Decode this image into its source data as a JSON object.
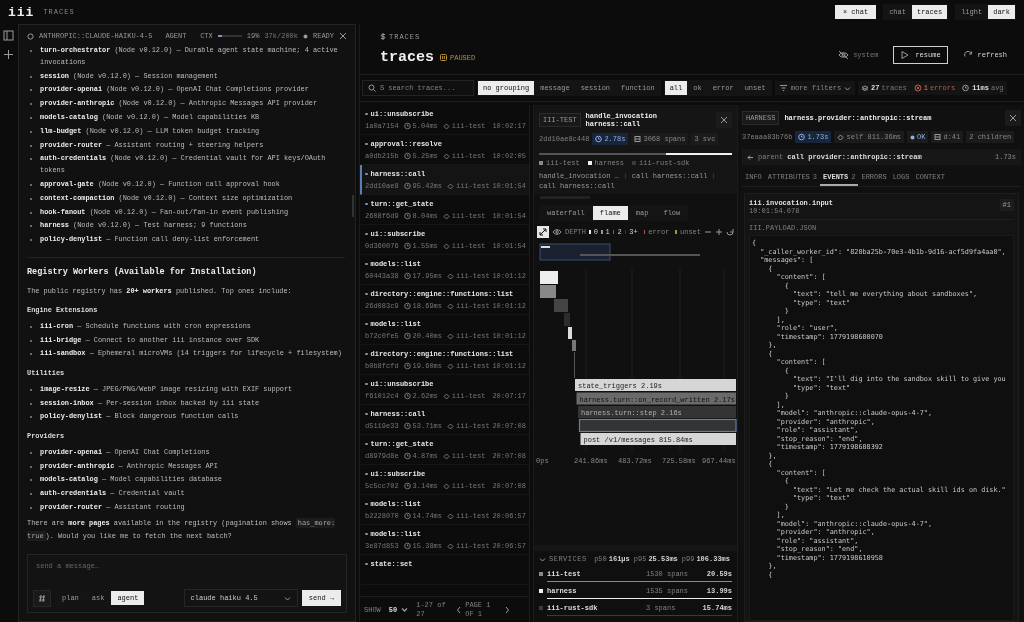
{
  "app": {
    "logo": "iii",
    "section": "TRACES"
  },
  "top_bar": {
    "close_chat": "× chat",
    "view_toggle": [
      {
        "label": "chat",
        "selected": false
      },
      {
        "label": "traces",
        "selected": true
      }
    ],
    "theme_toggle": [
      {
        "label": "light",
        "selected": false
      },
      {
        "label": "dark",
        "selected": true
      }
    ]
  },
  "chat": {
    "model": "ANTHROPIC::CLAUDE-HAIKU-4-5",
    "mode": "AGENT",
    "ctx_label": "CTX",
    "ctx": {
      "level": 0.19
    },
    "ctx_percent": "19%",
    "ctx_tokens": "37k/200k",
    "status": "READY",
    "blocks": [
      {
        "kind": "item",
        "text": "**turn-orchestrator** (Node v0.12.0) — Durable agent state machine; 4 active invocations"
      },
      {
        "kind": "item",
        "text": "**session** (Node v0.12.0) — Session management"
      },
      {
        "kind": "item",
        "text": "**provider-openai** (Node v0.12.0) — OpenAI Chat Completions provider"
      },
      {
        "kind": "item",
        "text": "**provider-anthropic** (Node v0.12.0) — Anthropic Messages API provider"
      },
      {
        "kind": "item",
        "text": "**models-catalog** (Node v0.12.0) — Model capabilities KB"
      },
      {
        "kind": "item",
        "text": "**llm-budget** (Node v0.12.0) — LLM token budget tracking"
      },
      {
        "kind": "item",
        "text": "**provider-router** — Assistant routing + steering helpers"
      },
      {
        "kind": "item",
        "text": "**auth-credentials** (Node v0.12.0) — Credential vault for API keys/OAuth tokens"
      },
      {
        "kind": "item",
        "text": "**approval-gate** (Node v0.12.0) — Function call approval hook"
      },
      {
        "kind": "item",
        "text": "**context-compaction** (Node v0.12.0) — Context size optimization"
      },
      {
        "kind": "item",
        "text": "**hook-fanout** (Node v0.12.0) — Fan-out/fan-in event publishing"
      },
      {
        "kind": "item",
        "text": "**harness** (Node v0.12.0) — Test harness; 9 functions"
      },
      {
        "kind": "item",
        "text": "**policy-denylist** — Function call deny-list enforcement"
      },
      {
        "kind": "divider"
      },
      {
        "kind": "heading",
        "text": "Registry Workers (Available for Installation)"
      },
      {
        "kind": "paragraph",
        "text": "The public registry has **20+ workers** published. Top ones include:"
      },
      {
        "kind": "subheading",
        "text": "Engine Extensions"
      },
      {
        "kind": "item",
        "text": "**iii-cron** — Schedule functions with cron expressions"
      },
      {
        "kind": "item",
        "text": "**iii-bridge** — Connect to another iii instance over SDK"
      },
      {
        "kind": "item",
        "text": "**iii-sandbox** — Ephemeral microVMs (14 triggers for lifecycle + filesystem)"
      },
      {
        "kind": "subheading",
        "text": "Utilities"
      },
      {
        "kind": "item",
        "text": "**image-resize** — JPEG/PNG/WebP image resizing with EXIF support"
      },
      {
        "kind": "item",
        "text": "**session-inbox** — Per-session inbox backed by iii state"
      },
      {
        "kind": "item",
        "text": "**policy-denylist** — Block dangerous function calls"
      },
      {
        "kind": "subheading",
        "text": "Providers"
      },
      {
        "kind": "item",
        "text": "**provider-openai** — OpenAI Chat Completions"
      },
      {
        "kind": "item",
        "text": "**provider-anthropic** — Anthropic Messages API"
      },
      {
        "kind": "item",
        "text": "**models-catalog** — Model capabilities database"
      },
      {
        "kind": "item",
        "text": "**auth-credentials** — Credential vault"
      },
      {
        "kind": "item",
        "text": "**provider-router** — Assistant routing"
      },
      {
        "kind": "code_paragraph",
        "before": "There are **more pages** available in the registry (pagination shows",
        "code": "has_more: true",
        "after": "). Would you like me to fetch the next batch?"
      }
    ],
    "composer": {
      "placeholder": "send a message…",
      "modes": [
        {
          "label": "plan",
          "selected": false
        },
        {
          "label": "ask",
          "selected": false
        },
        {
          "label": "agent",
          "selected": true
        }
      ],
      "model": "claude haiku 4.5",
      "send": "send →"
    }
  },
  "traces": {
    "section": "TRACES",
    "title": "traces",
    "status": "PAUSED",
    "actions": [
      {
        "kind": "system",
        "label": "system"
      },
      {
        "kind": "resume",
        "label": "resume"
      },
      {
        "kind": "refresh",
        "label": "refresh"
      }
    ],
    "search": {
      "placeholder": "search traces...",
      "shortcut": "S"
    },
    "grouping": [
      {
        "label": "no grouping",
        "selected": true
      },
      {
        "label": "message",
        "selected": false
      },
      {
        "label": "session",
        "selected": false
      },
      {
        "label": "function",
        "selected": false
      }
    ],
    "status_filter": [
      {
        "label": "all",
        "selected": true
      },
      {
        "label": "ok",
        "selected": false
      },
      {
        "label": "error",
        "selected": false
      },
      {
        "label": "unset",
        "selected": false
      }
    ],
    "more_filters": "more filters",
    "stats": [
      {
        "kind": "traces",
        "value": "27",
        "label": "traces"
      },
      {
        "kind": "errors",
        "value": "1",
        "label": "errors"
      },
      {
        "kind": "avg",
        "value": "11ms",
        "label": "avg"
      }
    ],
    "rows": [
      {
        "name": "ui::unsubscribe",
        "id": "1a0a7154",
        "duration": "5.04ms",
        "service": "iii-test",
        "time": "10:02:17",
        "selected": false
      },
      {
        "name": "approval::resolve",
        "id": "a0db215b",
        "duration": "5.25ms",
        "service": "iii-test",
        "time": "10:02:05",
        "selected": false
      },
      {
        "name": "harness::call",
        "id": "2dd10ae8",
        "duration": "95.42ms",
        "service": "iii-test",
        "time": "10:01:54",
        "selected": true
      },
      {
        "name": "turn::get_state",
        "id": "2608f6d9",
        "duration": "8.04ms",
        "service": "iii-test",
        "time": "10:01:54",
        "selected": false
      },
      {
        "name": "ui::subscribe",
        "id": "0d360076",
        "duration": "1.55ms",
        "service": "iii-test",
        "time": "10:01:54",
        "selected": false
      },
      {
        "name": "models::list",
        "id": "60443a38",
        "duration": "17.95ms",
        "service": "iii-test",
        "time": "10:01:12",
        "selected": false
      },
      {
        "name": "directory::engine::functions::list",
        "id": "26d083c9",
        "duration": "18.69ms",
        "service": "iii-test",
        "time": "10:01:12",
        "selected": false
      },
      {
        "name": "models::list",
        "id": "b72c0fe5",
        "duration": "20.40ms",
        "service": "iii-test",
        "time": "10:01:12",
        "selected": false
      },
      {
        "name": "directory::engine::functions::list",
        "id": "b0b8fcfd",
        "duration": "19.60ms",
        "service": "iii-test",
        "time": "10:01:12",
        "selected": false
      },
      {
        "name": "ui::unsubscribe",
        "id": "f61012c4",
        "duration": "2.62ms",
        "service": "iii-test",
        "time": "20:07:17",
        "selected": false
      },
      {
        "name": "harness::call",
        "id": "d5119e33",
        "duration": "53.71ms",
        "service": "iii-test",
        "time": "20:07:08",
        "selected": false
      },
      {
        "name": "turn::get_state",
        "id": "d8979d8e",
        "duration": "4.87ms",
        "service": "iii-test",
        "time": "20:07:08",
        "selected": false
      },
      {
        "name": "ui::subscribe",
        "id": "5c5cc702",
        "duration": "3.14ms",
        "service": "iii-test",
        "time": "20:07:08",
        "selected": false
      },
      {
        "name": "models::list",
        "id": "b2228070",
        "duration": "14.74ms",
        "service": "iii-test",
        "time": "20:06:57",
        "selected": false
      },
      {
        "name": "models::list",
        "id": "3e87d853",
        "duration": "15.38ms",
        "service": "iii-test",
        "time": "20:06:57",
        "selected": false
      },
      {
        "name": "state::set",
        "selected": false
      }
    ],
    "footer": {
      "show_label": "SHOW",
      "page_size": "50",
      "range": "1-27 of 27",
      "page": "PAGE 1 OF 1"
    },
    "trace_detail": {
      "service": "III-TEST",
      "title": "handle_invocation harness::call",
      "id": "2dd10ae8c448",
      "duration": "2.78s",
      "spans": "3068 spans",
      "services": "3 svc",
      "legend": [
        {
          "label": "iii-test",
          "color": "#8a8a8a"
        },
        {
          "label": "harness",
          "color": "#f0f0f0"
        },
        {
          "label": "iii-rust-sdk",
          "color": "#3a3a3a"
        }
      ],
      "breadcrumbs": [
        "handle_invocation …",
        "call harness::call",
        "call harness::call"
      ],
      "views": [
        {
          "label": "waterfall",
          "selected": false
        },
        {
          "label": "flame",
          "selected": true
        },
        {
          "label": "map",
          "selected": false
        },
        {
          "label": "flow",
          "selected": false
        }
      ],
      "depth_label": "DEPTH",
      "depths": [
        "0",
        "1",
        "2",
        "3+"
      ],
      "status_legend": [
        {
          "label": "error",
          "color": "#b5544a"
        },
        {
          "label": "unset",
          "color": "#a89240"
        }
      ],
      "bars": [
        {
          "label": "state_triggers  2.19s",
          "kind": "light",
          "selected": false
        },
        {
          "label": "harness.turn::on_record_written  2.17s",
          "kind": "mid",
          "selected": false
        },
        {
          "label": "harness.turn::step  2.16s",
          "kind": "dark",
          "selected": false
        },
        {
          "kind": "dark",
          "selected": true
        },
        {
          "label": "post /v1/messages  815.84ms",
          "kind": "light",
          "selected": false
        }
      ],
      "axis": [
        "0ps",
        "241.86ms",
        "483.72ms",
        "725.58ms",
        "967.44ms"
      ],
      "services_panel": {
        "label": "SERVICES",
        "p50_label": "p50",
        "p50": "161µs",
        "p95_label": "p95",
        "p95": "25.53ms",
        "p99_label": "p99",
        "p99": "106.33ms",
        "rows": [
          {
            "name": "iii-test",
            "spans": "1530 spans",
            "total": "20.59s",
            "color": "#8a8a8a"
          },
          {
            "name": "harness",
            "spans": "1535 spans",
            "total": "13.99s",
            "color": "#f0f0f0"
          },
          {
            "name": "iii-rust-sdk",
            "spans": "3 spans",
            "total": "15.74ms",
            "color": "#3a3a3a"
          }
        ]
      }
    },
    "span_detail": {
      "service": "HARNESS",
      "title": "harness.provider::anthropic::stream",
      "id": "37eaaa83b76b",
      "duration": "1.73s",
      "self": "self 811.36ms",
      "status": "OK",
      "depth": "d:41",
      "children": "2 children",
      "parent_label": "parent",
      "parent": "call provider::anthropic::stream",
      "parent_duration": "1.73s",
      "tabs": [
        {
          "label": "INFO",
          "selected": false
        },
        {
          "label": "ATTRIBUTES",
          "count": "3",
          "selected": false
        },
        {
          "label": "EVENTS",
          "count": "2",
          "selected": true
        },
        {
          "label": "ERRORS",
          "selected": false
        },
        {
          "label": "LOGS",
          "selected": false
        },
        {
          "label": "CONTEXT",
          "selected": false
        }
      ],
      "event": {
        "name": "iii.invocation.input",
        "time": "10:01:54.078",
        "index": "#1",
        "payload_label": "III.PAYLOAD.JSON",
        "code_lines": [
          "{",
          "  \"_caller_worker_id\": \"820ba25b-70e3-4b1b-9d16-acf5d9fa4aa0\",",
          "  \"messages\": [",
          "    {",
          "      \"content\": [",
          "        {",
          "          \"text\": \"tell me everything about sandboxes\",",
          "          \"type\": \"text\"",
          "        }",
          "      ],",
          "      \"role\": \"user\",",
          "      \"timestamp\": 1779198600070",
          "    },",
          "    {",
          "      \"content\": [",
          "        {",
          "          \"text\": \"I'll dig into the sandbox skill to give you",
          "          \"type\": \"text\"",
          "        }",
          "      ],",
          "      \"model\": \"anthropic::claude-opus-4-7\",",
          "      \"provider\": \"anthropic\",",
          "      \"role\": \"assistant\",",
          "      \"stop_reason\": \"end\",",
          "      \"timestamp\": 1779198608392",
          "    },",
          "    {",
          "      \"content\": [",
          "        {",
          "          \"text\": \"Let me check the actual skill ids on disk.\"",
          "          \"type\": \"text\"",
          "        }",
          "      ],",
          "      \"model\": \"anthropic::claude-opus-4-7\",",
          "      \"provider\": \"anthropic\",",
          "      \"role\": \"assistant\",",
          "      \"stop_reason\": \"end\",",
          "      \"timestamp\": 1779198610958",
          "    },",
          "    {"
        ]
      }
    }
  }
}
